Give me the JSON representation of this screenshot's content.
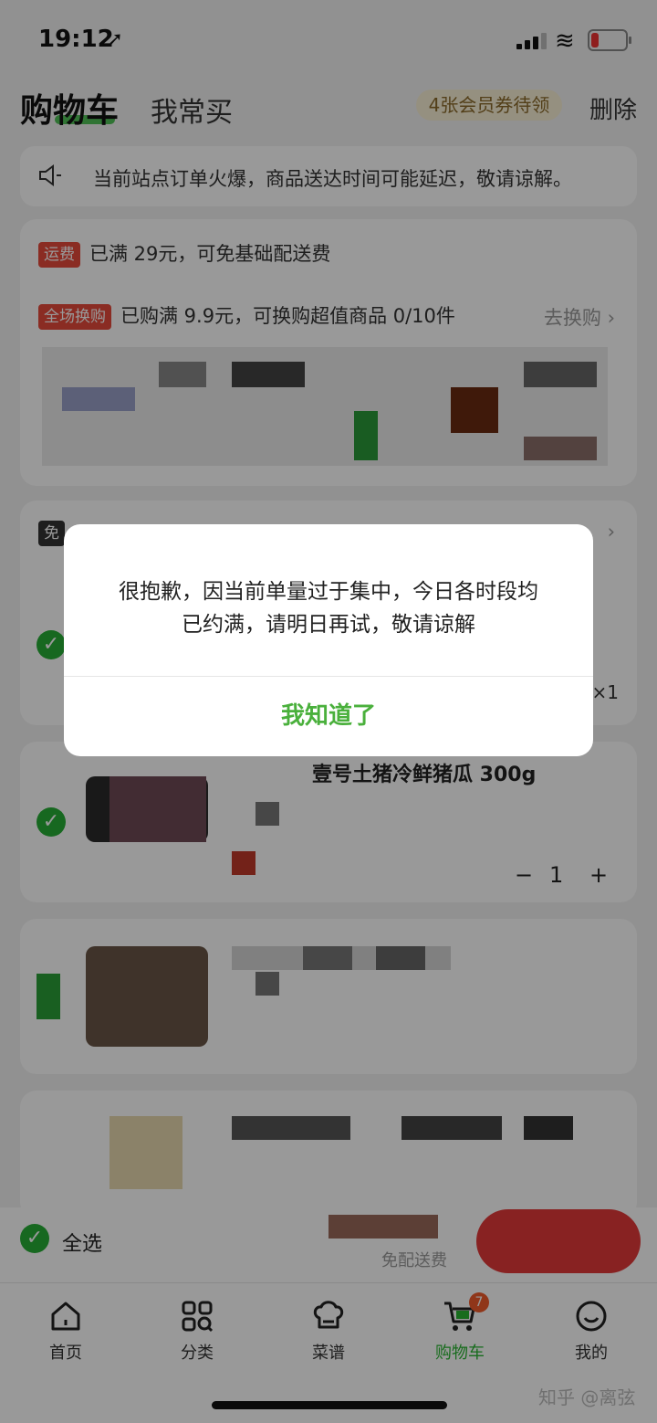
{
  "status_bar": {
    "time": "19:12",
    "location_glyph": "➚",
    "wifi_glyph": "≋"
  },
  "header": {
    "tab_active": "购物车",
    "tab_secondary": "我常买",
    "coupon": "4张会员券待领",
    "delete": "删除"
  },
  "notice": {
    "text": "当前站点订单火爆，商品送达时间可能延迟，敬请谅解。"
  },
  "promo": {
    "shipping_tag": "运费",
    "shipping_text": "已满 29元，可免基础配送费",
    "exchange_tag": "全场换购",
    "exchange_text": "已购满 9.9元，可换购超值商品 0/10件",
    "exchange_link": "去换购 ›"
  },
  "card2": {
    "tag_partial": "免",
    "arrow": "›",
    "qty_label": "×1"
  },
  "item3": {
    "title_partial": "壹号土猪冷鲜猪瓜 300g",
    "minus": "−",
    "qty": "1",
    "plus": "+"
  },
  "bottom_bar": {
    "select_all": "全选",
    "free_shipping": "免配送费"
  },
  "tabbar": {
    "items": [
      {
        "label": "首页",
        "icon": "home-icon"
      },
      {
        "label": "分类",
        "icon": "category-icon"
      },
      {
        "label": "菜谱",
        "icon": "chef-hat-icon"
      },
      {
        "label": "购物车",
        "icon": "cart-icon"
      },
      {
        "label": "我的",
        "icon": "smile-icon"
      }
    ],
    "cart_badge": "7"
  },
  "watermark": "知乎 @离弦",
  "dialog": {
    "message_line1": "很抱歉，因当前单量过于集中，今日各时段均",
    "message_line2": "已约满，请明日再试，敬请谅解",
    "ok_button": "我知道了"
  },
  "colors": {
    "accent": "#28b431",
    "tag_red": "#e64a3b",
    "badge": "#f05a2b"
  }
}
